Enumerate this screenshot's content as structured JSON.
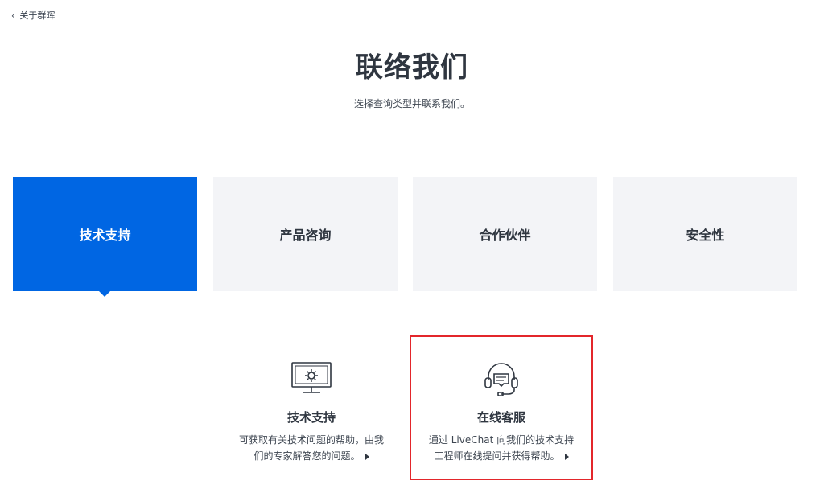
{
  "nav": {
    "back_label": "关于群晖"
  },
  "header": {
    "title": "联络我们",
    "subtitle": "选择查询类型并联系我们。"
  },
  "tabs": [
    {
      "label": "技术支持",
      "active": true
    },
    {
      "label": "产品咨询",
      "active": false
    },
    {
      "label": "合作伙伴",
      "active": false
    },
    {
      "label": "安全性",
      "active": false
    }
  ],
  "cards": [
    {
      "icon": "monitor-gear-icon",
      "title": "技术支持",
      "desc_line1": "可获取有关技术问题的帮助，由我",
      "desc_line2": "们的专家解答您的问题。"
    },
    {
      "icon": "headset-chat-icon",
      "title": "在线客服",
      "desc_line1": "通过 LiveChat 向我们的技术支持",
      "desc_line2": "工程师在线提问并获得帮助。",
      "highlighted": true
    }
  ],
  "colors": {
    "accent": "#0066e3",
    "tab_bg": "#f3f4f7",
    "highlight": "#e3262b",
    "text": "#2f3640"
  }
}
